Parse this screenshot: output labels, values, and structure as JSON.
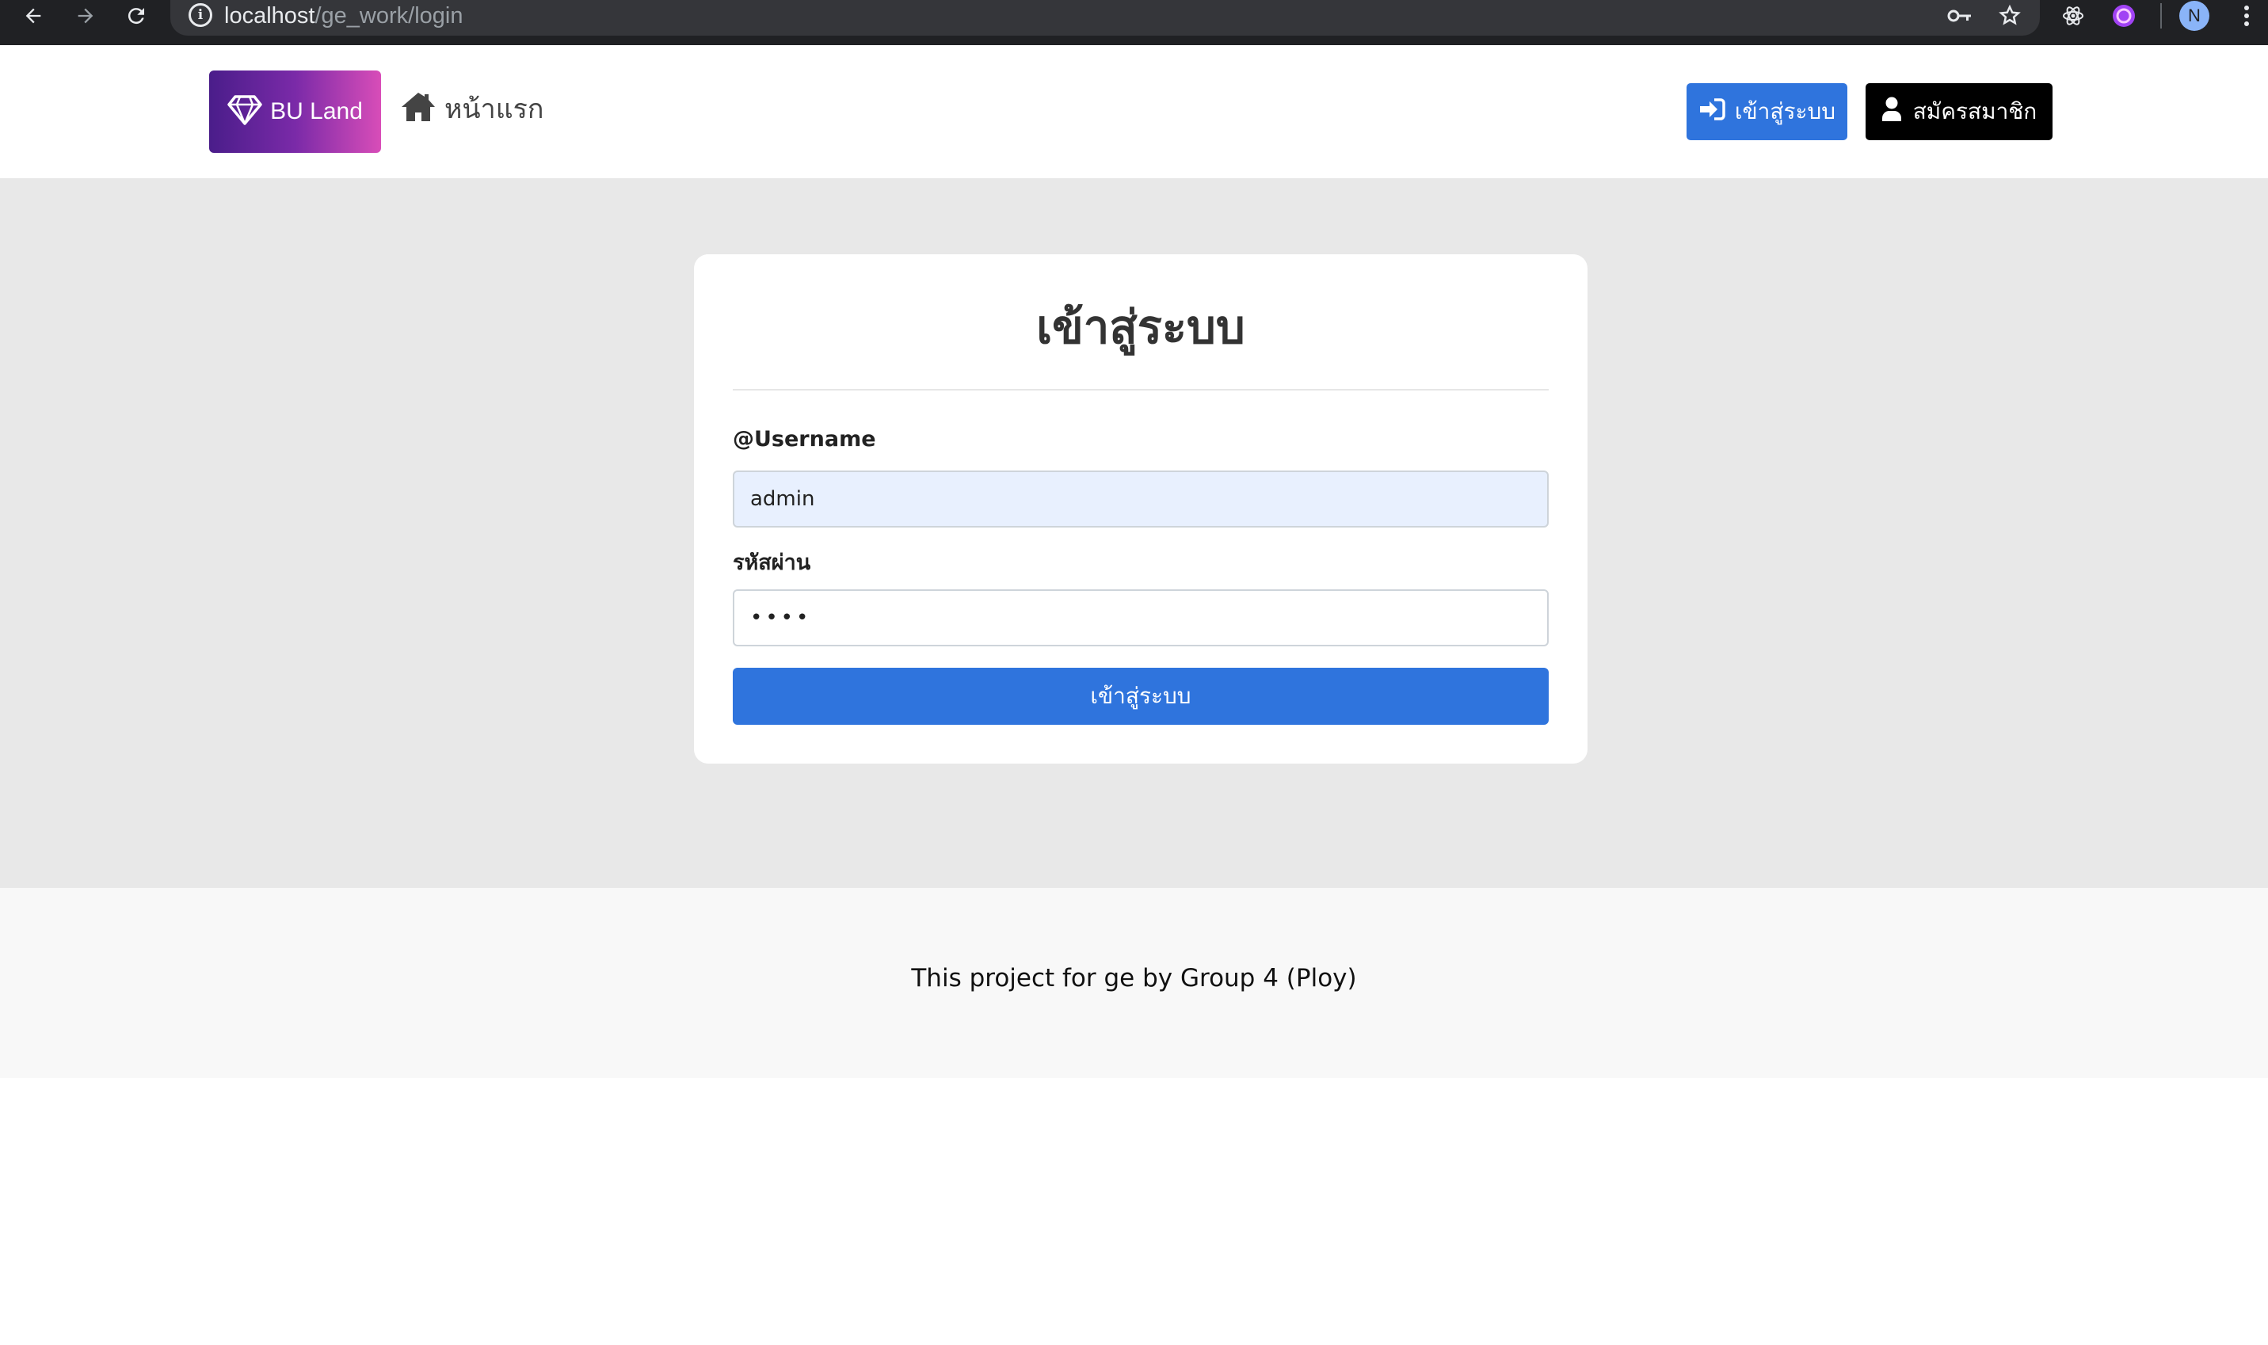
{
  "browser": {
    "url_host": "localhost",
    "url_path": "/ge_work/login",
    "profile_initial": "N",
    "info_glyph": "i"
  },
  "navbar": {
    "brand": "BU Land",
    "home": "หน้าแรก",
    "login": "เข้าสู่ระบบ",
    "register": "สมัครสมาชิก"
  },
  "login_form": {
    "title": "เข้าสู่ระบบ",
    "username_label": "@Username",
    "username_value": "admin",
    "password_label": "รหัสผ่าน",
    "password_value": "••••",
    "submit": "เข้าสู่ระบบ"
  },
  "footer": {
    "text": "This project for ge by Group 4 (Ploy)"
  },
  "colors": {
    "primary": "#2f74dd",
    "register_bg": "#000000",
    "brand_gradient_start": "#4a1d8a",
    "brand_gradient_end": "#d84db8",
    "page_bg": "#e8e8e8",
    "autofill_bg": "#e8f0fe"
  },
  "icons": [
    "back-arrow-icon",
    "forward-arrow-icon",
    "reload-icon",
    "info-icon",
    "key-icon",
    "star-icon",
    "react-devtools-icon",
    "extension-icon",
    "menu-dots-icon",
    "diamond-icon",
    "home-icon",
    "sign-in-icon",
    "user-icon"
  ]
}
